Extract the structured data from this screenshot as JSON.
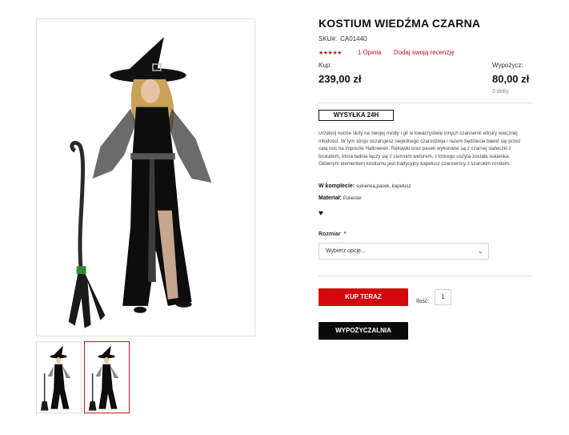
{
  "product": {
    "title": "KOSTIUM WIEDŹMA CZARNA",
    "sku_label": "SKU#:",
    "sku_value": "CA01440",
    "stars": "★★★★★",
    "reviews_link": "1 Opinia",
    "add_review_link": "Dodaj swoją recenzję"
  },
  "pricing": {
    "buy_label": "Kup:",
    "buy_price": "239,00 zł",
    "rent_label": "Wypożycz:",
    "rent_price": "80,00 zł",
    "rent_period": "3 doby"
  },
  "shipping_badge": "WYSYŁKA 24H",
  "description": "Urzeknij nocne słoty na swojej miotły i gil w towarzystwie innych czarownic elksiry wiecznej młodości. W tym stroju oczarujesz niejednego czarodzieja i razem będziecie bawić się przez całą noc na imprezie Halloween. Rękawki oraz pasek wykonane są z czarnej siateczki z brokatem, która tadnie łączy się z ciemnim welurem, z którego uszyta została sukienka. Głównym elementem kostiumu jest tradycyjny kapelusz czarownicy z szarokim rondem.",
  "details": {
    "kit_label": "W komplecie:",
    "kit_value": "sukienka,pasek, kapelusz",
    "material_label": "Materiał:",
    "material_value": "Poliester"
  },
  "size": {
    "label": "Rozmiar",
    "required_mark": "*",
    "selected": "Wybierz opcję..."
  },
  "actions": {
    "buy_button": "KUP TERAZ",
    "qty_label": "Ilość:",
    "qty_value": "1",
    "rent_button": "WYPOŻYCZALNIA"
  },
  "colors": {
    "accent_red": "#d3080c",
    "button_black": "#0a0a0a"
  },
  "icons": {
    "wishlist": "heart-icon",
    "select": "chevron-down-icon"
  }
}
